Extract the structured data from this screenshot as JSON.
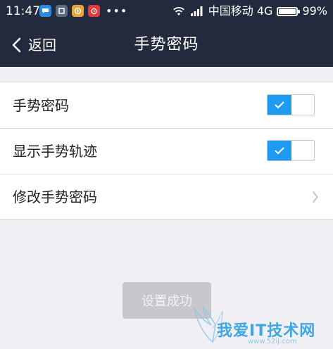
{
  "status_bar": {
    "time": "11:47",
    "notification_icons": [
      "chat-icon",
      "app-icon",
      "compass-icon",
      "alarm-icon"
    ],
    "more_dots": "•••",
    "carrier": "中国移动 4G",
    "battery_percent": "99%",
    "battery_level": 0.99
  },
  "nav": {
    "back_label": "返回",
    "title": "手势密码"
  },
  "settings": {
    "items": [
      {
        "label": "手势密码",
        "control": "toggle",
        "on": true
      },
      {
        "label": "显示手势轨迹",
        "control": "toggle",
        "on": true
      },
      {
        "label": "修改手势密码",
        "control": "chevron"
      }
    ]
  },
  "toast": {
    "message": "设置成功"
  },
  "watermark": {
    "text": "我爱IT技术网",
    "url": "www.52ij.com"
  },
  "colors": {
    "header_bg": "#232a3d",
    "page_bg": "#efeff4",
    "toggle_accent": "#1e9bf0"
  }
}
